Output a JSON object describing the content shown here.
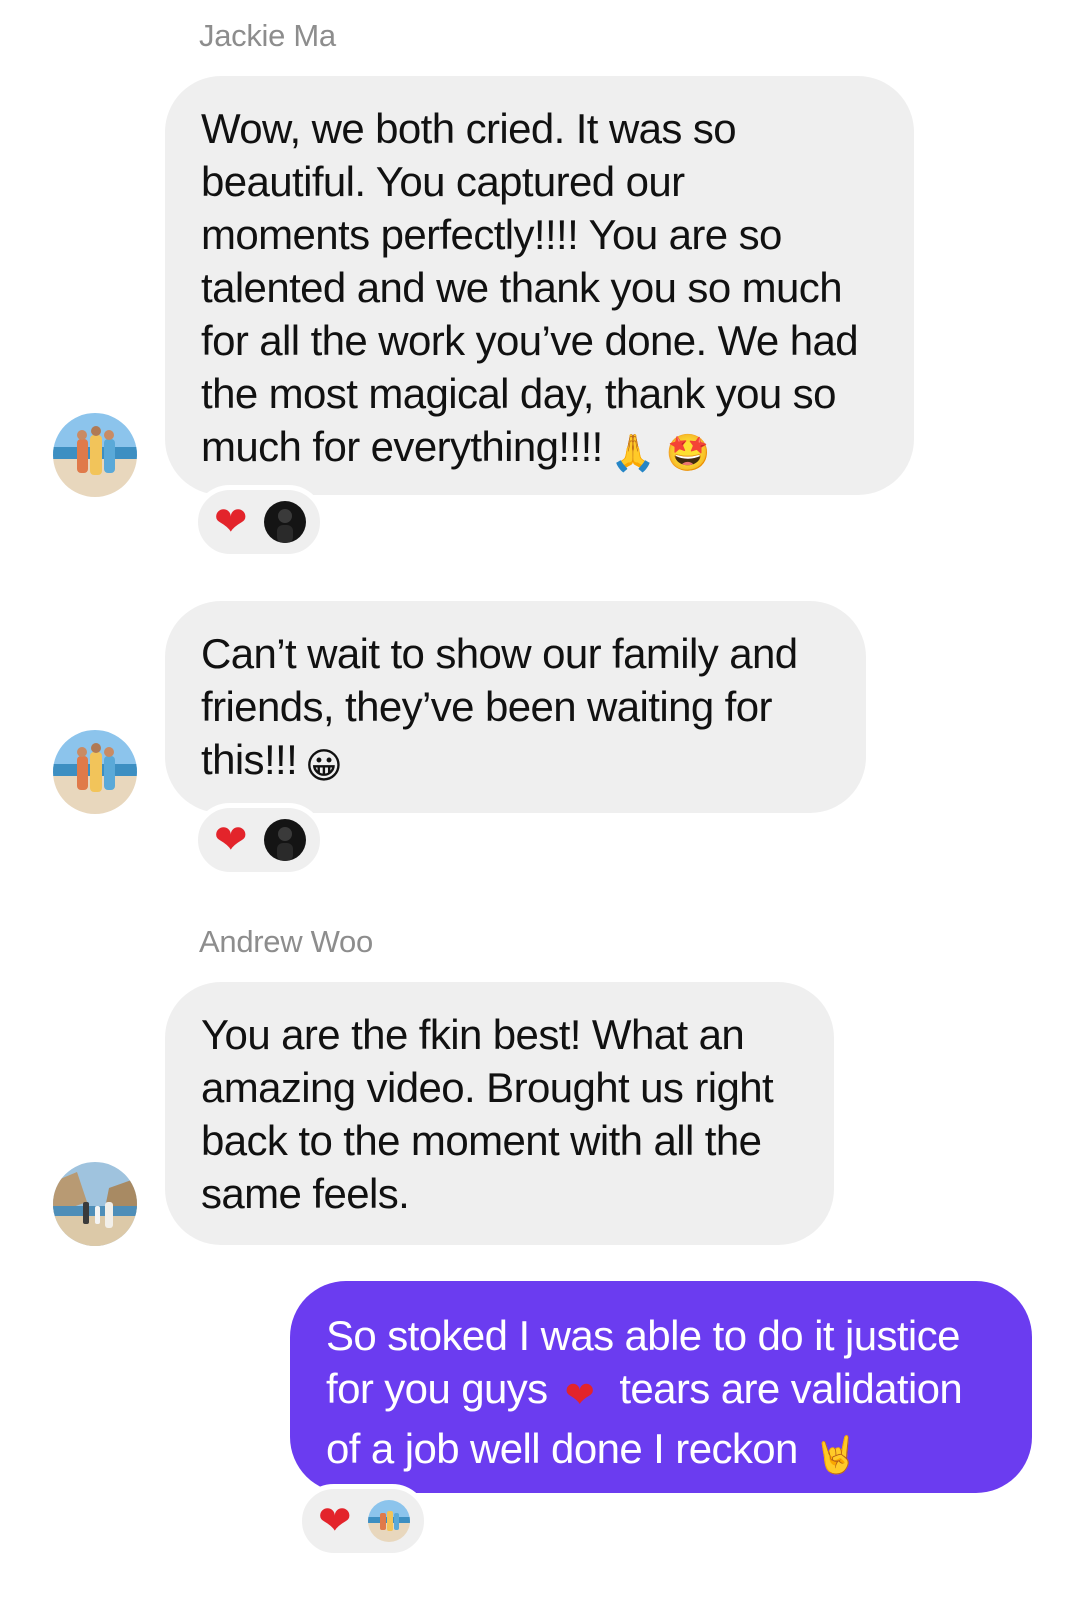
{
  "conversation": {
    "senders": {
      "jackie": "Jackie Ma",
      "andrew": "Andrew Woo"
    },
    "messages": [
      {
        "text": "Wow, we both cried. It was so\nbeautiful. You captured our\nmoments perfectly!!!! You are so\ntalented and we thank you so much\nfor all the work you’ve done. We had\nthe most magical day, thank you so\nmuch for everything!!!!",
        "emoji": "🙏 🤩",
        "reaction": "❤"
      },
      {
        "text": "Can’t wait to show our family and\nfriends, they’ve been waiting for\nthis!!!",
        "emoji": "😀",
        "reaction": "❤"
      },
      {
        "text": "You are the fkin best! What an\namazing video. Brought us right\nback to the moment with all the\nsame feels."
      },
      {
        "text_line1": "So stoked I was able to do it justice",
        "text_line2_a": "for you guys",
        "text_line2_emoji": "❤",
        "text_line2_b": "tears are validation",
        "text_line3": "of a job well done I reckon",
        "text_line3_emoji": "🤘",
        "reaction": "❤"
      }
    ]
  },
  "colors": {
    "incoming_bubble": "#efefef",
    "outgoing_bubble": "#6b3cf0",
    "sender_name": "#8d8d8d",
    "heart": "#e3242b"
  },
  "icons": {
    "reaction_heart": "heart-icon",
    "avatar_beach": "beach-photo-avatar",
    "avatar_cliff": "cliff-photo-avatar",
    "reactor_dark": "dark-profile-avatar"
  }
}
